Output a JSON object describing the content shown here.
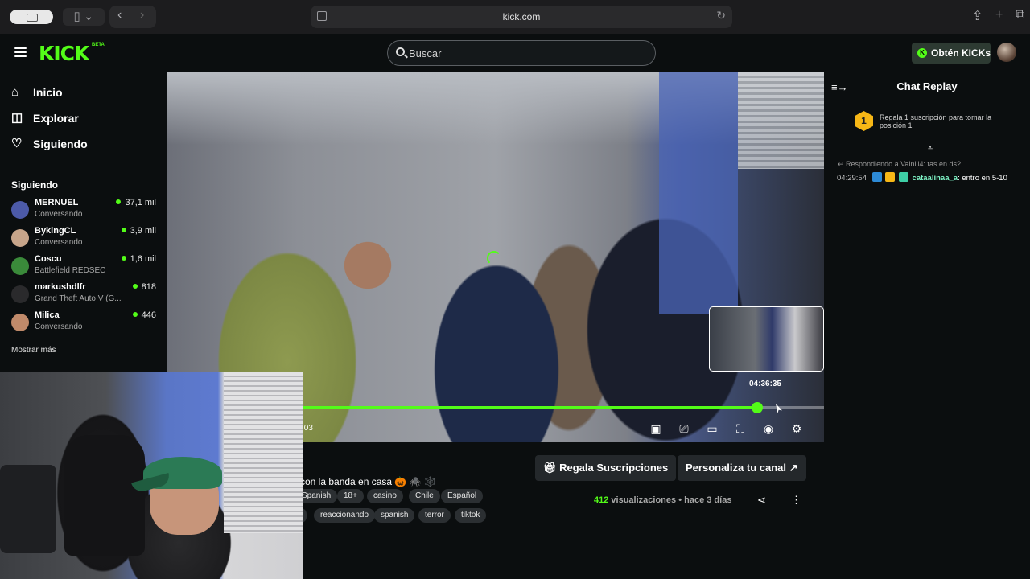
{
  "browser": {
    "url": "kick.com"
  },
  "header": {
    "logo": "KICK",
    "logo_tag": "BETA",
    "search_placeholder": "Buscar",
    "kicks_button": "Obtén KICKs"
  },
  "sidebar": {
    "nav": [
      {
        "label": "Inicio",
        "icon": "home-icon"
      },
      {
        "label": "Explorar",
        "icon": "compass-icon"
      },
      {
        "label": "Siguiendo",
        "icon": "heart-icon"
      }
    ],
    "following_title": "Siguiendo",
    "channels": [
      {
        "name": "MERNUEL",
        "game": "Conversando",
        "viewers": "37,1 mil",
        "color": "#4c5aa8"
      },
      {
        "name": "BykingCL",
        "game": "Conversando",
        "viewers": "3,9 mil",
        "color": "#c7a58a"
      },
      {
        "name": "Coscu",
        "game": "Battlefield REDSEC",
        "viewers": "1,6 mil",
        "color": "#3a8a3a"
      },
      {
        "name": "markushdlfr",
        "game": "Grand Theft Auto V (G...",
        "viewers": "818",
        "color": "#2a2a2c"
      },
      {
        "name": "Milica",
        "game": "Conversando",
        "viewers": "446",
        "color": "#c08a6a"
      }
    ],
    "show_more": "Mostrar más"
  },
  "player": {
    "hover_time": "04:36:35",
    "current_time": ":03",
    "progress_fraction": 0.872
  },
  "video_info": {
    "title": "con la banda en casa 🎃 🕷️ 🕸️",
    "tags_row1": [
      "Spanish",
      "18+",
      "casino",
      "Chile",
      "Español"
    ],
    "tags_row2": [
      "",
      "reaccionando",
      "spanish",
      "terror",
      "tiktok"
    ],
    "gift_button": "Regala Suscripciones",
    "customize_button": "Personaliza tu canal",
    "views_number": "412",
    "views_label": "visualizaciones",
    "dot": "•",
    "uploaded": "hace 3 días"
  },
  "chat": {
    "title": "Chat Replay",
    "gift_rank": "1",
    "gift_text": "Regala 1 suscripción para tomar la posición 1",
    "reply_to": "Respondiendo a Vainill4: tas en ds?",
    "message": {
      "timestamp": "04:29:54",
      "username": "cataalinaa_a",
      "text": "entro en 5-10"
    }
  },
  "colors": {
    "accent": "#53fc18",
    "background": "#0b0e0f"
  }
}
